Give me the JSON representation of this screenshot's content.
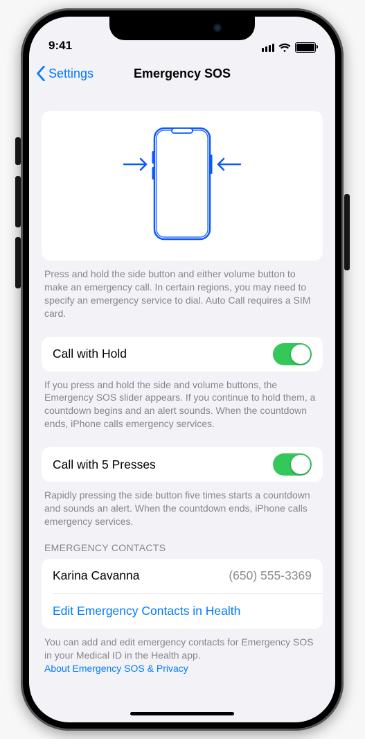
{
  "status": {
    "time": "9:41"
  },
  "nav": {
    "back_label": "Settings",
    "title": "Emergency SOS"
  },
  "hero": {
    "help": "Press and hold the side button and either volume button to make an emergency call. In certain regions, you may need to specify an emergency service to dial. Auto Call requires a SIM card."
  },
  "call_hold": {
    "label": "Call with Hold",
    "on": true,
    "help": "If you press and hold the side and volume buttons, the Emergency SOS slider appears. If you continue to hold them, a countdown begins and an alert sounds. When the countdown ends, iPhone calls emergency services."
  },
  "call_5": {
    "label": "Call with 5 Presses",
    "on": true,
    "help": "Rapidly pressing the side button five times starts a countdown and sounds an alert. When the countdown ends, iPhone calls emergency services."
  },
  "contacts": {
    "header": "EMERGENCY CONTACTS",
    "items": [
      {
        "name": "Karina Cavanna",
        "phone": "(650) 555-3369"
      }
    ],
    "edit_label": "Edit Emergency Contacts in Health",
    "help": "You can add and edit emergency contacts for Emergency SOS in your Medical ID in the Health app.",
    "privacy_link": "About Emergency SOS & Privacy"
  }
}
